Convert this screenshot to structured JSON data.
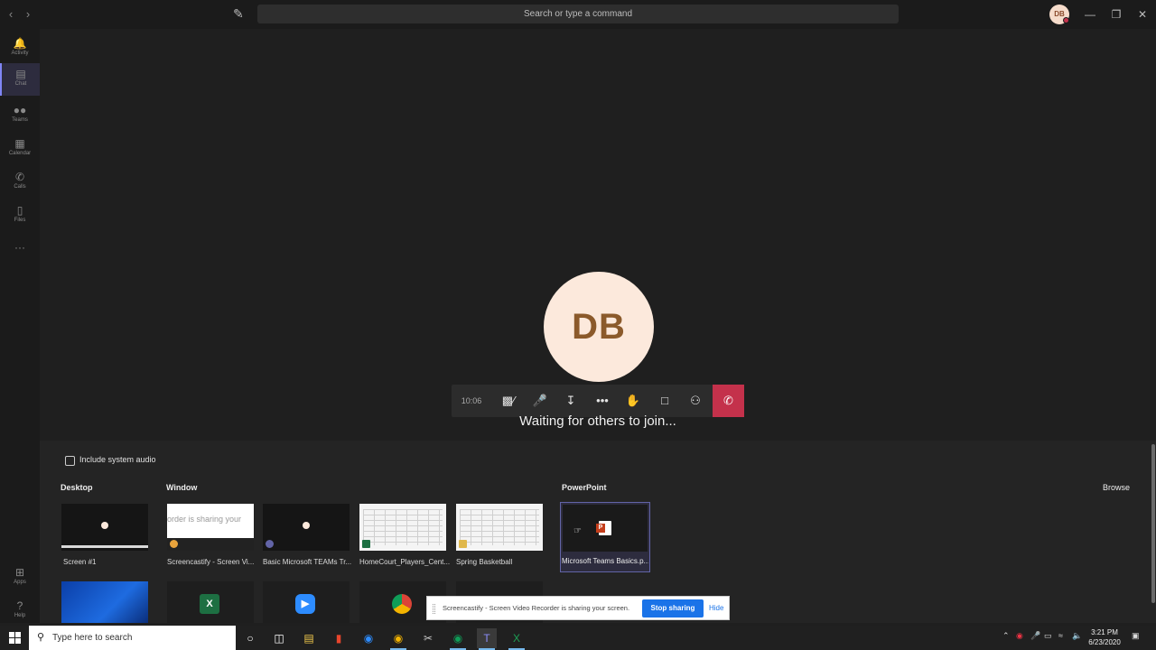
{
  "titlebar": {
    "search_placeholder": "Search or type a command",
    "avatar_initials": "DB"
  },
  "rail": {
    "items": [
      {
        "label": "Activity",
        "icon": "bell-icon"
      },
      {
        "label": "Chat",
        "icon": "chat-icon"
      },
      {
        "label": "Teams",
        "icon": "teams-icon"
      },
      {
        "label": "Calendar",
        "icon": "calendar-icon"
      },
      {
        "label": "Calls",
        "icon": "phone-icon"
      },
      {
        "label": "Files",
        "icon": "file-icon"
      }
    ],
    "bottom": [
      {
        "label": "Apps",
        "icon": "apps-icon"
      },
      {
        "label": "Help",
        "icon": "help-icon"
      }
    ]
  },
  "call": {
    "avatar_initials": "DB",
    "timer": "10:06",
    "status_text": "Waiting for others to join..."
  },
  "share_tray": {
    "include_audio_label": "Include system audio",
    "desktop_title": "Desktop",
    "window_title": "Window",
    "powerpoint_title": "PowerPoint",
    "browse_label": "Browse",
    "screen_caption": "Screen #1",
    "windows": [
      {
        "caption": "Screencastify - Screen Vi...",
        "snippet": "order is sharing your"
      },
      {
        "caption": "Basic Microsoft TEAMs Tr..."
      },
      {
        "caption": "HomeCourt_Players_Cent..."
      },
      {
        "caption": "Spring Basketball"
      }
    ],
    "powerpoint_file": "Microsoft Teams Basics.p..."
  },
  "share_notification": {
    "text": "Screencastify - Screen Video Recorder is sharing your screen.",
    "stop_label": "Stop sharing",
    "hide_label": "Hide"
  },
  "taskbar": {
    "search_placeholder": "Type here to search",
    "time": "3:21 PM",
    "date": "6/23/2020"
  },
  "colors": {
    "accent": "#6264a7",
    "hangup": "#c4314b",
    "stop_share": "#1a73e8"
  }
}
